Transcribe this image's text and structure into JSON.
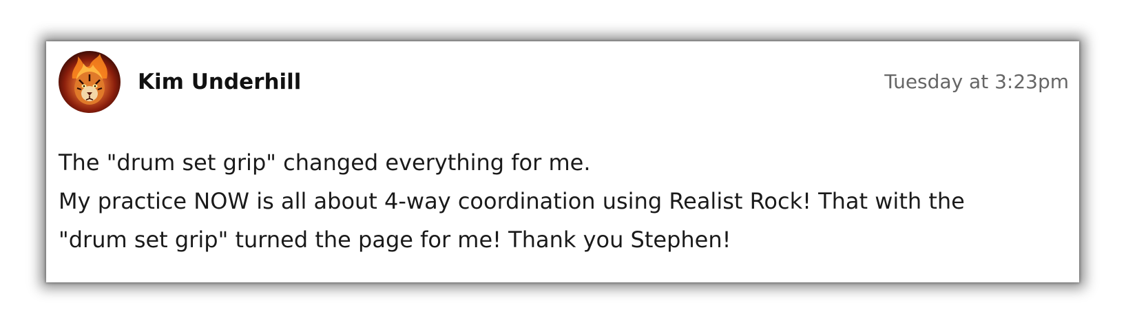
{
  "comment": {
    "author": "Kim Underhill",
    "timestamp": "Tuesday at 3:23pm",
    "avatar": "flaming-tiger-avatar",
    "body_lines": [
      "The \"drum set grip\" changed everything for me.",
      "My practice NOW is all about 4-way coordination using Realist Rock! That with the",
      "\"drum set grip\" turned the page for me! Thank you Stephen!"
    ]
  },
  "colors": {
    "author_text": "#111111",
    "timestamp_text": "#666666",
    "body_text": "#1a1a1a",
    "card_background": "#ffffff"
  }
}
